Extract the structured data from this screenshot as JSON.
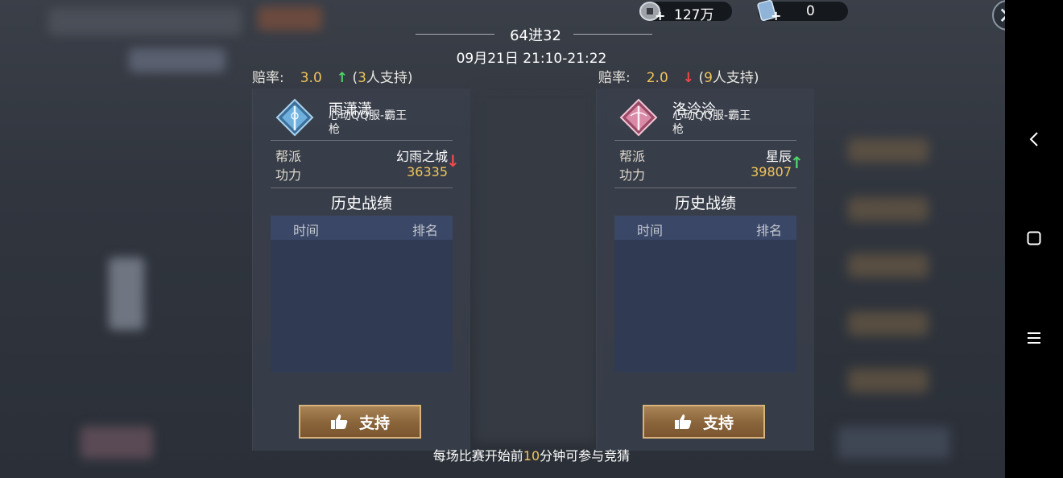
{
  "resources": {
    "coins": {
      "icon": "coin-stack-icon",
      "value": "127万"
    },
    "tickets": {
      "icon": "ticket-scroll-icon",
      "value": "0"
    }
  },
  "match": {
    "round": "64进32",
    "datetime": "09月21日 21:10-21:22",
    "footer_prefix": "每场比赛开始前",
    "footer_highlight": "10",
    "footer_suffix": "分钟可参与竞猜"
  },
  "left": {
    "odds_label": "赔率:",
    "odds_value": "3.0",
    "odds_trend": "up",
    "supporters_prefix": "(",
    "supporters_count": "3",
    "supporters_suffix": "人支持)",
    "name": "雨潇潇",
    "server_line1": "心动QQ服-霸王",
    "server_line2": "枪",
    "guild_label": "帮派",
    "guild_value": "幻雨之城",
    "power_label": "功力",
    "power_value": "36335",
    "power_trend": "down",
    "history_title": "历史战绩",
    "col_time": "时间",
    "col_rank": "排名",
    "support_label": "支持",
    "emblem_color": "#5aa7d8"
  },
  "right": {
    "odds_label": "赔率:",
    "odds_value": "2.0",
    "odds_trend": "down",
    "supporters_prefix": "(",
    "supporters_count": "9",
    "supporters_suffix": "人支持)",
    "name": "洛泠泠",
    "server_line1": "心动QQ服-霸王",
    "server_line2": "枪",
    "guild_label": "帮派",
    "guild_value": "星辰",
    "power_label": "功力",
    "power_value": "39807",
    "power_trend": "up",
    "history_title": "历史战绩",
    "col_time": "时间",
    "col_rank": "排名",
    "support_label": "支持",
    "emblem_color": "#d98aa6"
  },
  "system_nav": {
    "back": "back-icon",
    "home": "home-square-icon",
    "menu": "menu-lines-icon"
  },
  "colors": {
    "accent_gold": "#f1c35c",
    "up_green": "#4fd36a",
    "down_red": "#f04848"
  }
}
